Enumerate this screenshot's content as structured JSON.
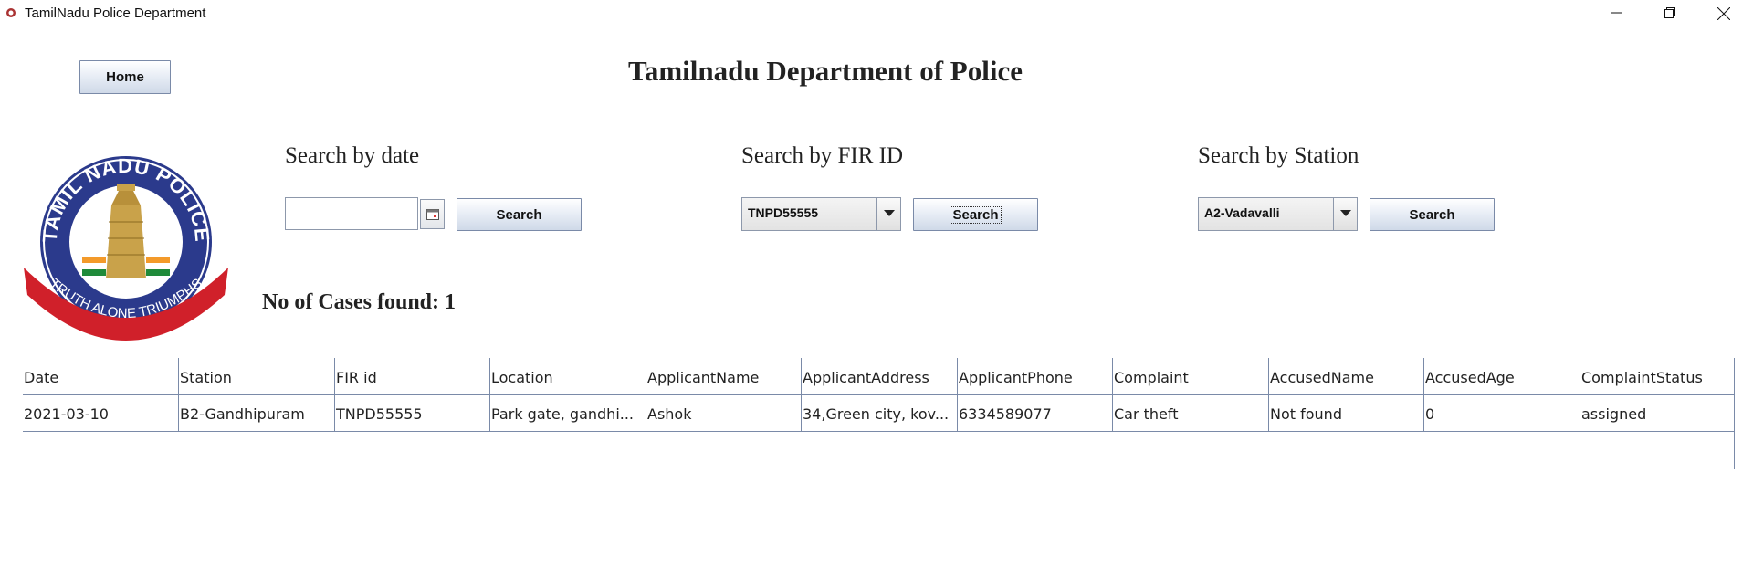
{
  "window": {
    "title": "TamilNadu Police Department",
    "controls": [
      "minimize-icon",
      "restore-icon",
      "close-icon"
    ]
  },
  "header": {
    "home_label": "Home",
    "title": "Tamilnadu Department of Police"
  },
  "logo": {
    "top_text": "TAMIL NADU POLICE",
    "motto": "TRUTH ALONE TRIUMPHS"
  },
  "search_date": {
    "label": "Search by date",
    "value": "",
    "button": "Search"
  },
  "search_fir": {
    "label": "Search by FIR ID",
    "selected": "TNPD55555",
    "button": "Search"
  },
  "search_station": {
    "label": "Search by Station",
    "selected": "A2-Vadavalli",
    "button": "Search"
  },
  "results": {
    "count_text": "No of Cases found: 1"
  },
  "table": {
    "columns": [
      "Date",
      "Station",
      "FIR id",
      "Location",
      "ApplicantName",
      "ApplicantAddress",
      "ApplicantPhone",
      "Complaint",
      "AccusedName",
      "AccusedAge",
      "ComplaintStatus"
    ],
    "rows": [
      [
        "2021-03-10",
        "B2-Gandhipuram",
        "TNPD55555",
        "Park gate, gandhi...",
        "Ashok",
        "34,Green city, kov...",
        "6334589077",
        "Car theft",
        "Not found",
        "0",
        "assigned"
      ]
    ]
  },
  "colors": {
    "logo_blue": "#2b3a8c",
    "logo_red": "#d0202a",
    "logo_gold": "#c9a24a"
  }
}
